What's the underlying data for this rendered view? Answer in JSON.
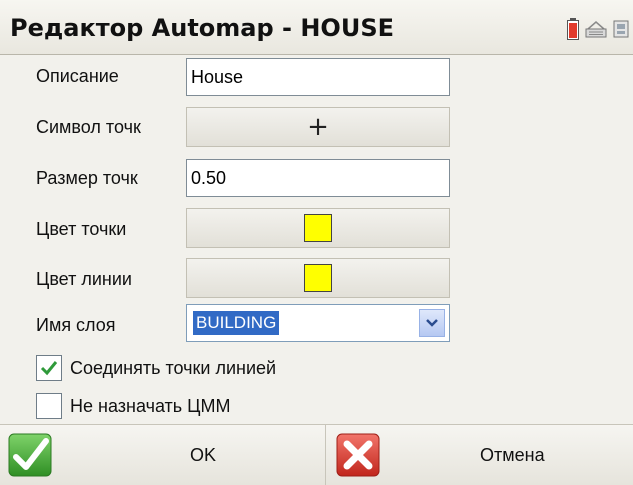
{
  "window": {
    "title": "Редактор Automap - HOUSE",
    "tray_icons": [
      "battery-icon",
      "keyboard-icon",
      "network-icon"
    ]
  },
  "form": {
    "description": {
      "label": "Описание",
      "value": "House"
    },
    "point_symbol": {
      "label": "Символ точк",
      "symbol": "+"
    },
    "point_size": {
      "label": "Размер точк",
      "value": "0.50"
    },
    "point_color": {
      "label": "Цвет точки",
      "color": "#ffff00"
    },
    "line_color": {
      "label": "Цвет линии",
      "color": "#ffff00"
    },
    "layer_name": {
      "label": "Имя слоя",
      "value": "BUILDING"
    },
    "connect_points": {
      "label": "Соединять точки линией",
      "checked": true
    },
    "no_dtm": {
      "label": "Не назначать ЦММ",
      "checked": false
    }
  },
  "footer": {
    "ok_label": "OK",
    "cancel_label": "Отмена"
  },
  "colors": {
    "ok_green": "#3aa12e",
    "cancel_red": "#d9342b",
    "selection_blue": "#316ac5"
  }
}
